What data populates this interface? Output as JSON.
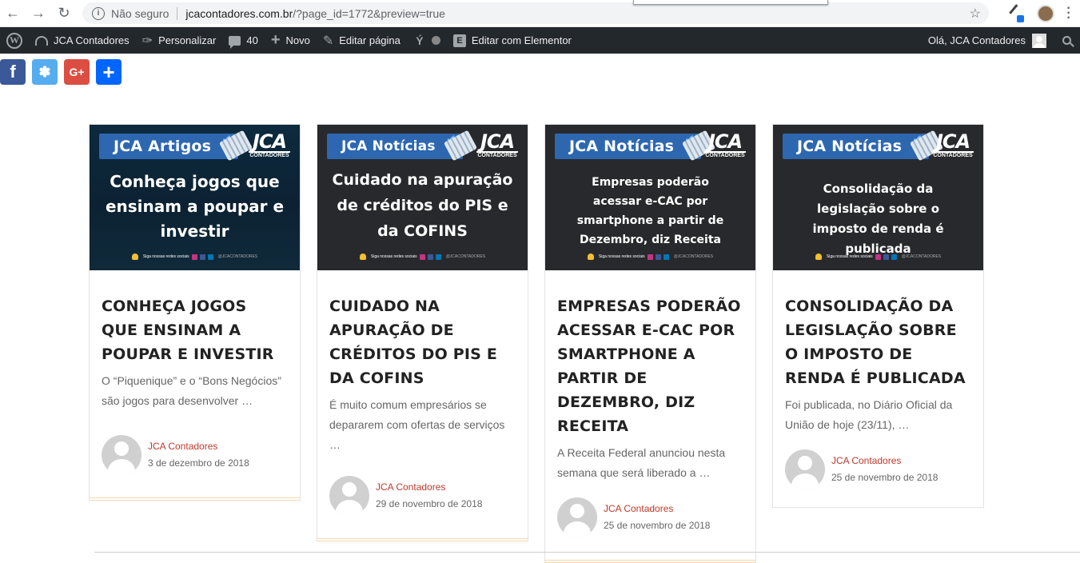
{
  "browser": {
    "security_label": "Não seguro",
    "url_host": "jcacontadores.com.br",
    "url_path": "/?page_id=1772&preview=true"
  },
  "adminbar": {
    "site_name": "JCA Contadores",
    "customize": "Personalizar",
    "comments_count": "40",
    "new": "Novo",
    "edit_page": "Editar página",
    "elementor": "Editar com Elementor",
    "greeting": "Olá, JCA Contadores"
  },
  "cards": [
    {
      "tag": "JCA Artigos",
      "thumb_headline": "Conheça jogos que ensinam a poupar e investir",
      "title": "CONHEÇA JOGOS QUE ENSINAM A POUPAR E INVESTIR",
      "excerpt": "O “Piquenique” e o “Bons Negócios” são jogos para desenvolver …",
      "author": "JCA Contadores",
      "date": "3 de dezembro de 2018"
    },
    {
      "tag": "JCA Notícias",
      "thumb_headline": "Cuidado na apuração de créditos do PIS e da COFINS",
      "title": "CUIDADO NA APURAÇÃO DE CRÉDITOS DO PIS E DA COFINS",
      "excerpt": "É muito comum empresários se depararem com ofertas de serviços …",
      "author": "JCA Contadores",
      "date": "29 de novembro de 2018"
    },
    {
      "tag": "JCA Notícias",
      "thumb_headline": "Empresas poderão acessar e-CAC por smartphone a partir de Dezembro, diz Receita",
      "title": "EMPRESAS PODERÃO ACESSAR E-CAC POR SMARTPHONE A PARTIR DE DEZEMBRO, DIZ RECEITA",
      "excerpt": "A Receita Federal anunciou nesta semana que será liberado a …",
      "author": "JCA Contadores",
      "date": "25 de novembro de 2018"
    },
    {
      "tag": "JCA Notícias",
      "thumb_headline": "Consolidação da legislação sobre o imposto de renda é publicada",
      "title": "CONSOLIDAÇÃO DA LEGISLAÇÃO SOBRE O IMPOSTO DE RENDA É PUBLICADA",
      "excerpt": "Foi publicada, no Diário Oficial da União de hoje (23/11), …",
      "author": "JCA Contadores",
      "date": "25 de novembro de 2018"
    }
  ],
  "thumb_brand": {
    "logo": "JCA",
    "logo_sub": "CONTADORES",
    "social_text": "Siga nossas redes sociais",
    "handle": "@JCACONTADORES"
  },
  "icons": {
    "back": "arrow-left-icon",
    "forward": "arrow-right-icon",
    "reload": "reload-icon",
    "facebook": "facebook-icon",
    "twitter": "twitter-icon",
    "google_plus": "google-plus-icon",
    "share": "share-plus-icon"
  },
  "colors": {
    "adminbar_bg": "#23282d",
    "author_red": "#c0392b",
    "tag_blue": "#2d67b0",
    "facebook": "#3b5998",
    "twitter": "#55acee",
    "google_plus": "#dc4e41",
    "share": "#0166ff"
  }
}
